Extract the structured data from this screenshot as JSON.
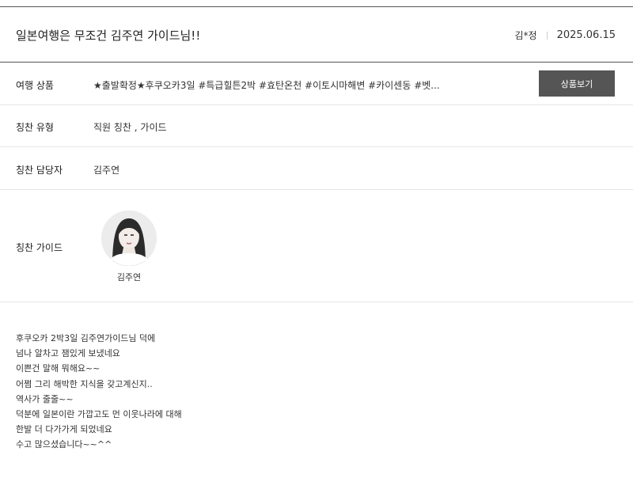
{
  "review": {
    "title": "일본여행은 무조건 김주연 가이드님!!",
    "author": "김*정",
    "date": "2025.06.15"
  },
  "fields": {
    "product_label": "여행 상품",
    "product_value": "★출발확정★후쿠오카3일 #특급힐튼2박 #효탄온천 #이토시마해변 #카이센동 #벳...",
    "product_button": "상품보기",
    "type_label": "칭찬 유형",
    "type_value": "직원 칭찬 , 가이드",
    "staff_label": "칭찬 담당자",
    "staff_value": "김주연",
    "guide_label": "칭찬 가이드",
    "guide_name": "김주연"
  },
  "content": {
    "lines": [
      "후쿠오카 2박3일 김주연가이드님 덕에",
      "넘나 알차고 잼있게 보냈네요",
      "이쁜건 말해 뭐해요~~",
      "어쩜 그리 해박한 지식을 갖고계신지..",
      "역사가 줄줄~~",
      "덕분에 일본이란 가깝고도 먼 이웃나라에 대해",
      "한발 더 다가가게 되었네요",
      "수고 많으셨습니다~~^^"
    ]
  }
}
